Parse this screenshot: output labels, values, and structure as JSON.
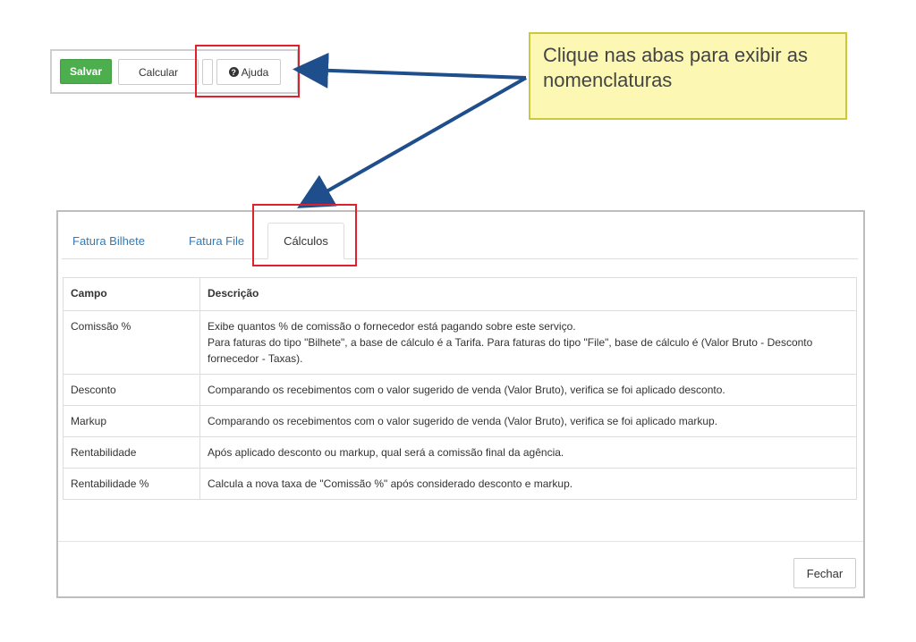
{
  "toolbar": {
    "save_label": "Salvar",
    "calc_label": "Calcular",
    "help_label": "Ajuda",
    "help_icon": "question-circle-icon",
    "help_icon_glyph": "?"
  },
  "callout": {
    "text": "Clique nas abas para exibir as nomenclaturas"
  },
  "modal": {
    "tabs": [
      {
        "label": "Fatura Bilhete"
      },
      {
        "label": "Fatura File"
      },
      {
        "label": "Cálculos"
      }
    ],
    "table": {
      "headers": [
        "Campo",
        "Descrição"
      ],
      "rows": [
        {
          "campo": "Comissão %",
          "descricao_lines": [
            "Exibe quantos % de comissão o fornecedor está pagando sobre este serviço.",
            "Para faturas do tipo \"Bilhete\", a base de cálculo é a Tarifa. Para faturas do tipo \"File\", base de cálculo é (Valor Bruto - Desconto fornecedor - Taxas)."
          ]
        },
        {
          "campo": "Desconto",
          "descricao_lines": [
            "Comparando os recebimentos com o valor sugerido de venda (Valor Bruto), verifica se foi aplicado desconto."
          ]
        },
        {
          "campo": "Markup",
          "descricao_lines": [
            "Comparando os recebimentos com o valor sugerido de venda (Valor Bruto), verifica se foi aplicado markup."
          ]
        },
        {
          "campo": "Rentabilidade",
          "descricao_lines": [
            "Após aplicado desconto ou markup, qual será a comissão final da agência."
          ]
        },
        {
          "campo": "Rentabilidade %",
          "descricao_lines": [
            "Calcula a nova taxa de \"Comissão %\" após considerado desconto e markup."
          ]
        }
      ]
    },
    "close_label": "Fechar"
  },
  "colors": {
    "save_button": "#4cae4c",
    "highlight": "#e0202a",
    "callout_bg": "#fcf8b3",
    "arrow": "#1f4e8c",
    "tab_link": "#337ab7"
  }
}
